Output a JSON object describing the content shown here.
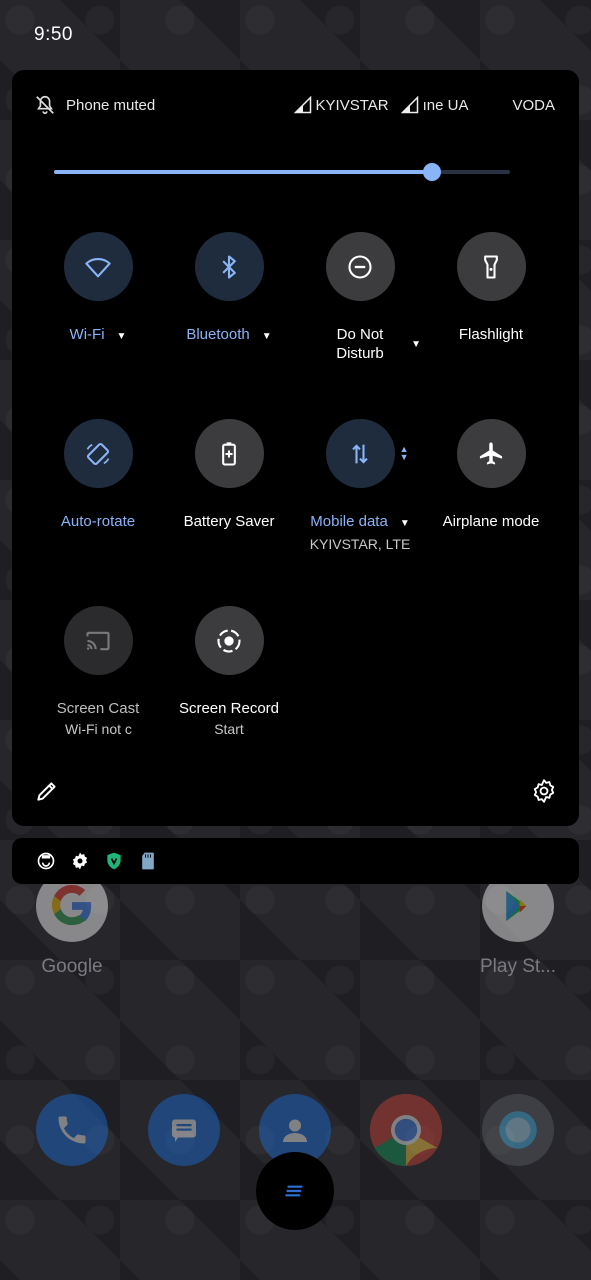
{
  "status_bar": {
    "time": "9:50"
  },
  "quick_settings": {
    "header": {
      "ringer_status": "Phone muted",
      "carriers": [
        "KYIVSTAR",
        "ıne UA",
        "VODA"
      ]
    },
    "brightness": {
      "level": 0.83
    },
    "tiles": [
      {
        "label": "Wi-Fi",
        "state": "on",
        "has_dropdown": true,
        "icon": "wifi-icon"
      },
      {
        "label": "Bluetooth",
        "state": "on",
        "has_dropdown": true,
        "icon": "bluetooth-icon"
      },
      {
        "label": "Do Not Disturb",
        "state": "off",
        "has_dropdown": true,
        "icon": "do-not-disturb-icon"
      },
      {
        "label": "Flashlight",
        "state": "off",
        "icon": "flashlight-icon"
      },
      {
        "label": "Auto-rotate",
        "state": "on",
        "icon": "auto-rotate-icon"
      },
      {
        "label": "Battery Saver",
        "state": "off",
        "icon": "battery-saver-icon"
      },
      {
        "label": "Mobile data",
        "sublabel": "KYIVSTAR, LTE",
        "state": "on",
        "has_dropdown": true,
        "icon": "mobile-data-icon"
      },
      {
        "label": "Airplane mode",
        "state": "off",
        "icon": "airplane-icon"
      },
      {
        "label": "Screen Cast",
        "sublabel": "Wi-Fi not c",
        "state": "unavailable",
        "icon": "screen-cast-icon"
      },
      {
        "label": "Screen Record",
        "sublabel": "Start",
        "state": "off",
        "icon": "screen-record-icon"
      }
    ]
  },
  "notification_icons": [
    "face-icon",
    "gear-icon",
    "shield-icon",
    "sd-card-icon"
  ],
  "home_screen": {
    "apps": [
      {
        "label": "Google",
        "icon": "google-icon"
      },
      {
        "label": "Play St...",
        "icon": "play-store-icon"
      }
    ],
    "dock": [
      "phone-icon",
      "messages-icon",
      "contacts-icon",
      "chrome-icon",
      "camera-icon"
    ]
  },
  "colors": {
    "accent": "#8ab4f8",
    "tile_on": "#1e2c3e",
    "tile_off": "#3c3c3f",
    "panel": "#000000"
  }
}
